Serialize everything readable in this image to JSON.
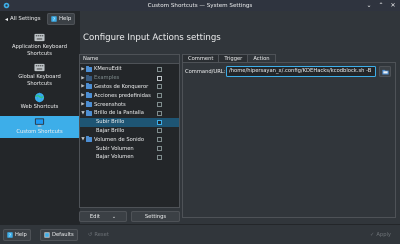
{
  "window": {
    "title": "Custom Shortcuts — System Settings"
  },
  "toolbar": {
    "all_settings_label": "All Settings",
    "help_label": "Help"
  },
  "sidebar": {
    "items": [
      {
        "label_line1": "Application Keyboard",
        "label_line2": "Shortcuts",
        "icon": "keyboard-icon"
      },
      {
        "label_line1": "Global Keyboard",
        "label_line2": "Shortcuts",
        "icon": "keyboard-icon"
      },
      {
        "label_line1": "Web Shortcuts",
        "label_line2": "",
        "icon": "globe-icon"
      },
      {
        "label_line1": "Custom Shortcuts",
        "label_line2": "",
        "icon": "computer-icon",
        "selected": true
      }
    ]
  },
  "page": {
    "title": "Configure Input Actions settings"
  },
  "tree": {
    "header": "Name",
    "rows": [
      {
        "label": "KMenuEdit",
        "expanded": false,
        "checked": true,
        "disabled": false
      },
      {
        "label": "Examples",
        "expanded": false,
        "checked": false,
        "disabled": true
      },
      {
        "label": "Gestos de Konqueror",
        "expanded": false,
        "checked": true,
        "disabled": false
      },
      {
        "label": "Acciones predefinidas",
        "expanded": false,
        "checked": true,
        "disabled": false
      },
      {
        "label": "Screenshots",
        "expanded": false,
        "checked": true,
        "disabled": false
      },
      {
        "label": "Brillo de la Pantalla",
        "expanded": true,
        "checked": true,
        "disabled": false
      },
      {
        "label": "Subir Brillo",
        "child": true,
        "checked": true,
        "selected": true
      },
      {
        "label": "Bajar Brillo",
        "child": true,
        "checked": true
      },
      {
        "label": "Volumen de Sonido",
        "expanded": true,
        "checked": true,
        "disabled": false
      },
      {
        "label": "Subir Volumen",
        "child": true,
        "checked": true
      },
      {
        "label": "Bajar Volumen",
        "child": true,
        "checked": true
      }
    ],
    "edit_label": "Edit",
    "settings_label": "Settings"
  },
  "tabs": [
    {
      "label": "Comment",
      "active": false
    },
    {
      "label": "Trigger",
      "active": false
    },
    {
      "label": "Action",
      "active": true
    }
  ],
  "action": {
    "command_label": "Command/URL:",
    "command_value": "/home/hipersayan_x/.config/KDEHacks/kcodblock.sh -B"
  },
  "bottom": {
    "help_label": "Help",
    "defaults_label": "Defaults",
    "reset_label": "Reset",
    "apply_label": "Apply"
  },
  "colors": {
    "accent": "#3daee9",
    "selection": "#1e5574",
    "folder": "#4d8fd4"
  }
}
